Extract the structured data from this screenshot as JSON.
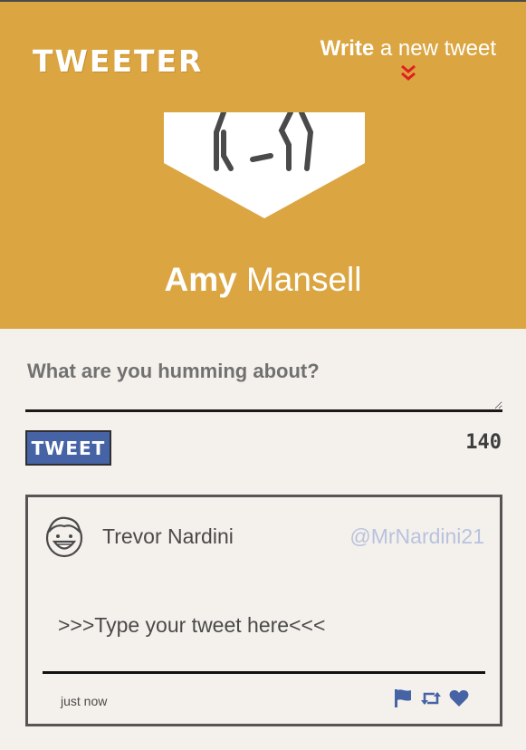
{
  "brand": "TWEETER",
  "compose_link": {
    "bold": "Write",
    "rest": " a new tweet"
  },
  "profile": {
    "first_name": "Amy",
    "last_name": "Mansell"
  },
  "composer": {
    "placeholder": "What are you humming about?",
    "counter": "140",
    "button_label": "TWEET"
  },
  "tweet": {
    "name": "Trevor Nardini",
    "handle": "@MrNardini21",
    "body": ">>>Type your tweet here<<<",
    "time": "just now"
  },
  "icons": [
    "double-chevron-down-icon",
    "flag-icon",
    "retweet-icon",
    "heart-icon",
    "avatar-icon"
  ],
  "colors": {
    "header": "#dba642",
    "accent": "#4663a6",
    "chevron": "#e02020",
    "background": "#f4f1ec"
  }
}
